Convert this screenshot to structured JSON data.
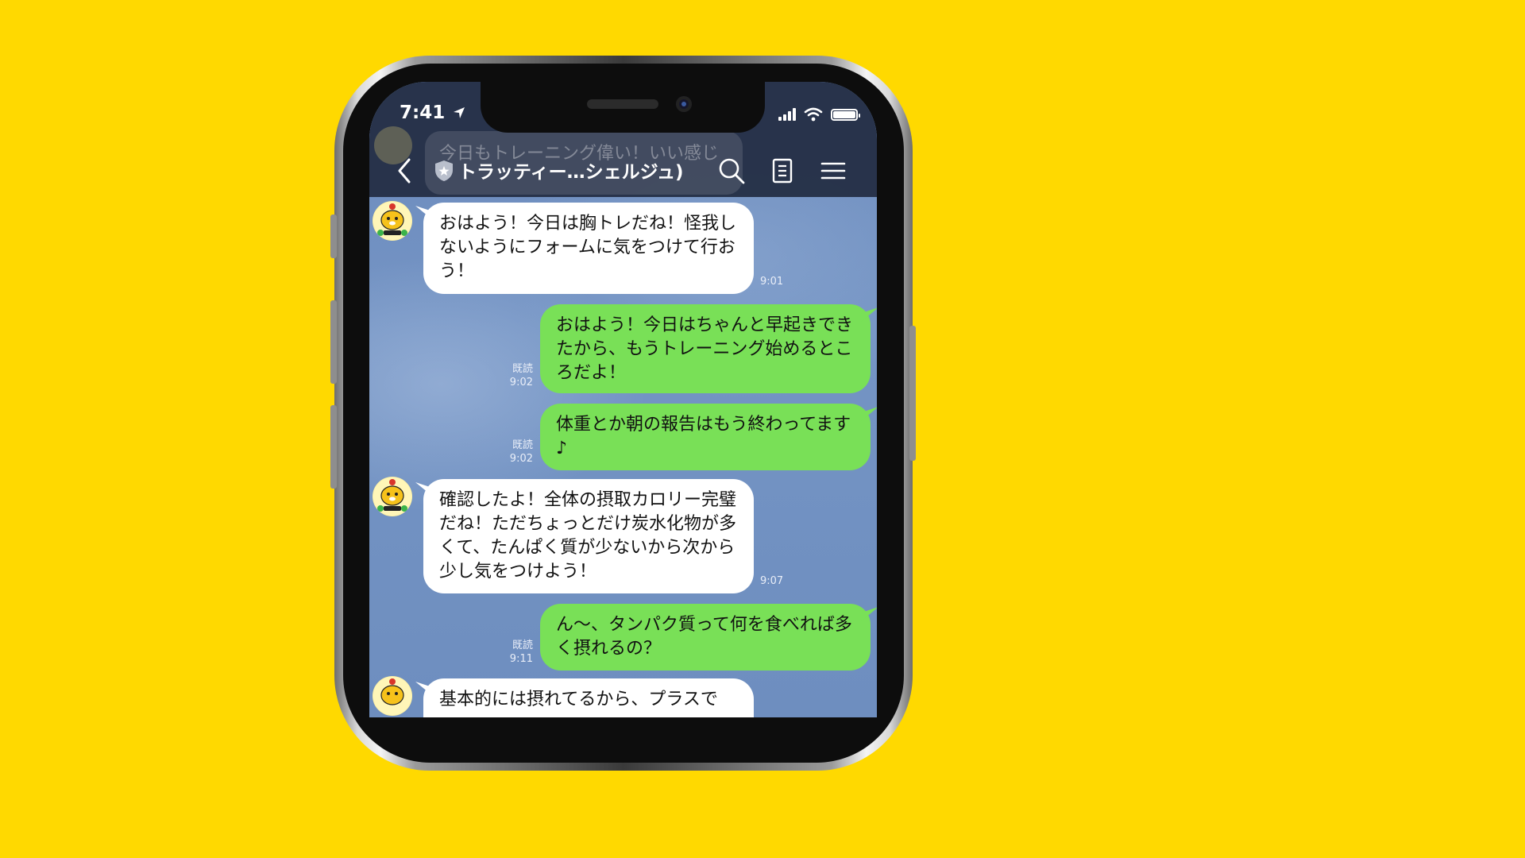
{
  "status_bar": {
    "time": "7:41"
  },
  "header": {
    "room_title": "トラッティー…シェルジュ)",
    "behind_preview": "今日もトレーニング偉い！いい感じ"
  },
  "icons": [
    "back-icon",
    "shield-star-icon",
    "search-icon",
    "notes-icon",
    "menu-icon",
    "location-arrow-icon",
    "wifi-icon",
    "battery-icon"
  ],
  "colors": {
    "background": "#FFD900",
    "incoming_bubble": "#FFFFFF",
    "outgoing_bubble": "#79E057",
    "chat_bg": "#6F8FBD"
  },
  "messages": [
    {
      "side": "in",
      "text": "おはよう！今日は胸トレだね！怪我しないようにフォームに気をつけて行おう！",
      "time": "9:01",
      "read": ""
    },
    {
      "side": "out",
      "text": "おはよう！今日はちゃんと早起きできたから、もうトレーニング始めるところだよ！",
      "time": "9:02",
      "read": "既読"
    },
    {
      "side": "out",
      "text": "体重とか朝の報告はもう終わってます♪",
      "time": "9:02",
      "read": "既読"
    },
    {
      "side": "in",
      "text": "確認したよ！全体の摂取カロリー完璧だね！ただちょっとだけ炭水化物が多くて、たんぱく質が少ないから次から少し気をつけよう！",
      "time": "9:07",
      "read": ""
    },
    {
      "side": "out",
      "text": "ん〜、タンパク質って何を食べれば多く摂れるの？",
      "time": "9:11",
      "read": "既読"
    },
    {
      "side": "in",
      "text": "基本的には摂れてるから、プラスで",
      "time": "",
      "read": ""
    }
  ]
}
